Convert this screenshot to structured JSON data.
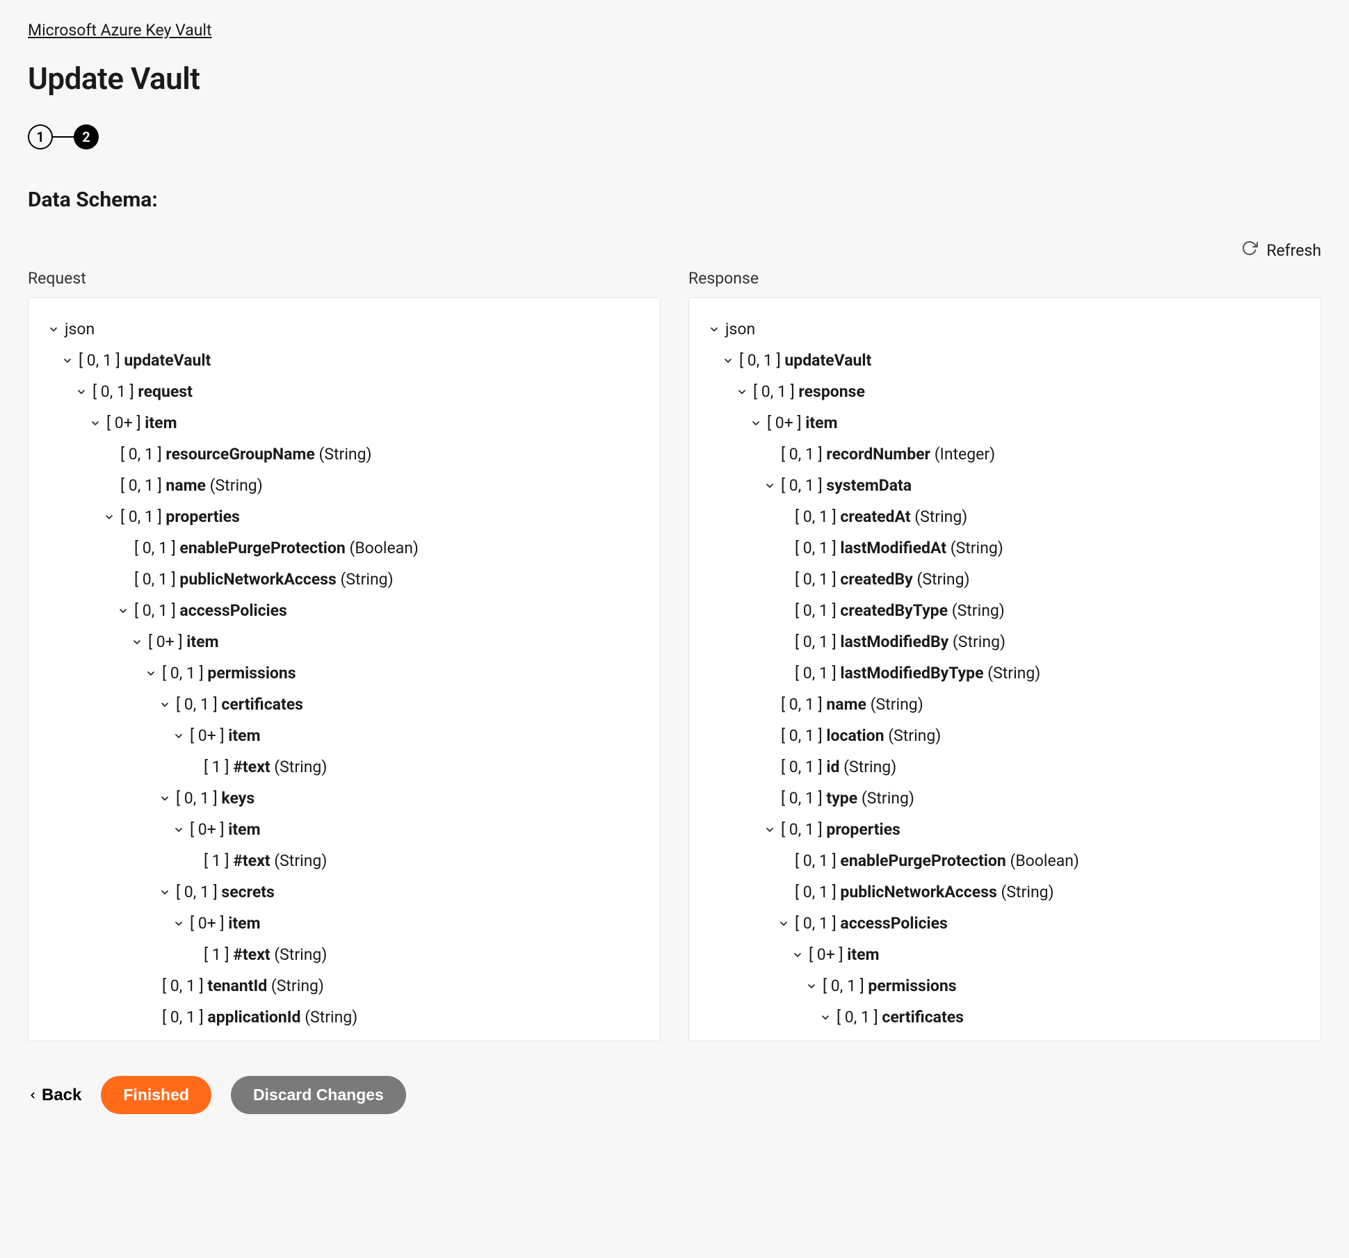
{
  "breadcrumb": "Microsoft Azure Key Vault",
  "page_title": "Update Vault",
  "stepper": {
    "step1": "1",
    "step2": "2"
  },
  "section_title": "Data Schema:",
  "refresh_label": "Refresh",
  "columns": {
    "request_title": "Request",
    "response_title": "Response"
  },
  "request_tree": [
    {
      "depth": 0,
      "chev": true,
      "card": "",
      "name": "json",
      "type": ""
    },
    {
      "depth": 1,
      "chev": true,
      "card": "[ 0, 1 ]",
      "name": "updateVault",
      "type": ""
    },
    {
      "depth": 2,
      "chev": true,
      "card": "[ 0, 1 ]",
      "name": "request",
      "type": ""
    },
    {
      "depth": 3,
      "chev": true,
      "card": "[ 0+ ]",
      "name": "item",
      "type": ""
    },
    {
      "depth": 4,
      "chev": false,
      "card": "[ 0, 1 ]",
      "name": "resourceGroupName",
      "type": "(String)"
    },
    {
      "depth": 4,
      "chev": false,
      "card": "[ 0, 1 ]",
      "name": "name",
      "type": "(String)"
    },
    {
      "depth": 4,
      "chev": true,
      "card": "[ 0, 1 ]",
      "name": "properties",
      "type": ""
    },
    {
      "depth": 5,
      "chev": false,
      "card": "[ 0, 1 ]",
      "name": "enablePurgeProtection",
      "type": "(Boolean)"
    },
    {
      "depth": 5,
      "chev": false,
      "card": "[ 0, 1 ]",
      "name": "publicNetworkAccess",
      "type": "(String)"
    },
    {
      "depth": 5,
      "chev": true,
      "card": "[ 0, 1 ]",
      "name": "accessPolicies",
      "type": ""
    },
    {
      "depth": 6,
      "chev": true,
      "card": "[ 0+ ]",
      "name": "item",
      "type": ""
    },
    {
      "depth": 7,
      "chev": true,
      "card": "[ 0, 1 ]",
      "name": "permissions",
      "type": ""
    },
    {
      "depth": 8,
      "chev": true,
      "card": "[ 0, 1 ]",
      "name": "certificates",
      "type": ""
    },
    {
      "depth": 9,
      "chev": true,
      "card": "[ 0+ ]",
      "name": "item",
      "type": ""
    },
    {
      "depth": 10,
      "chev": false,
      "card": "[ 1 ]",
      "name": "#text",
      "type": "(String)"
    },
    {
      "depth": 8,
      "chev": true,
      "card": "[ 0, 1 ]",
      "name": "keys",
      "type": ""
    },
    {
      "depth": 9,
      "chev": true,
      "card": "[ 0+ ]",
      "name": "item",
      "type": ""
    },
    {
      "depth": 10,
      "chev": false,
      "card": "[ 1 ]",
      "name": "#text",
      "type": "(String)"
    },
    {
      "depth": 8,
      "chev": true,
      "card": "[ 0, 1 ]",
      "name": "secrets",
      "type": ""
    },
    {
      "depth": 9,
      "chev": true,
      "card": "[ 0+ ]",
      "name": "item",
      "type": ""
    },
    {
      "depth": 10,
      "chev": false,
      "card": "[ 1 ]",
      "name": "#text",
      "type": "(String)"
    },
    {
      "depth": 7,
      "chev": false,
      "card": "[ 0, 1 ]",
      "name": "tenantId",
      "type": "(String)"
    },
    {
      "depth": 7,
      "chev": false,
      "card": "[ 0, 1 ]",
      "name": "applicationId",
      "type": "(String)"
    }
  ],
  "response_tree": [
    {
      "depth": 0,
      "chev": true,
      "card": "",
      "name": "json",
      "type": ""
    },
    {
      "depth": 1,
      "chev": true,
      "card": "[ 0, 1 ]",
      "name": "updateVault",
      "type": ""
    },
    {
      "depth": 2,
      "chev": true,
      "card": "[ 0, 1 ]",
      "name": "response",
      "type": ""
    },
    {
      "depth": 3,
      "chev": true,
      "card": "[ 0+ ]",
      "name": "item",
      "type": ""
    },
    {
      "depth": 4,
      "chev": false,
      "card": "[ 0, 1 ]",
      "name": "recordNumber",
      "type": "(Integer)"
    },
    {
      "depth": 4,
      "chev": true,
      "card": "[ 0, 1 ]",
      "name": "systemData",
      "type": ""
    },
    {
      "depth": 5,
      "chev": false,
      "card": "[ 0, 1 ]",
      "name": "createdAt",
      "type": "(String)"
    },
    {
      "depth": 5,
      "chev": false,
      "card": "[ 0, 1 ]",
      "name": "lastModifiedAt",
      "type": "(String)"
    },
    {
      "depth": 5,
      "chev": false,
      "card": "[ 0, 1 ]",
      "name": "createdBy",
      "type": "(String)"
    },
    {
      "depth": 5,
      "chev": false,
      "card": "[ 0, 1 ]",
      "name": "createdByType",
      "type": "(String)"
    },
    {
      "depth": 5,
      "chev": false,
      "card": "[ 0, 1 ]",
      "name": "lastModifiedBy",
      "type": "(String)"
    },
    {
      "depth": 5,
      "chev": false,
      "card": "[ 0, 1 ]",
      "name": "lastModifiedByType",
      "type": "(String)"
    },
    {
      "depth": 4,
      "chev": false,
      "card": "[ 0, 1 ]",
      "name": "name",
      "type": "(String)"
    },
    {
      "depth": 4,
      "chev": false,
      "card": "[ 0, 1 ]",
      "name": "location",
      "type": "(String)"
    },
    {
      "depth": 4,
      "chev": false,
      "card": "[ 0, 1 ]",
      "name": "id",
      "type": "(String)"
    },
    {
      "depth": 4,
      "chev": false,
      "card": "[ 0, 1 ]",
      "name": "type",
      "type": "(String)"
    },
    {
      "depth": 4,
      "chev": true,
      "card": "[ 0, 1 ]",
      "name": "properties",
      "type": ""
    },
    {
      "depth": 5,
      "chev": false,
      "card": "[ 0, 1 ]",
      "name": "enablePurgeProtection",
      "type": "(Boolean)"
    },
    {
      "depth": 5,
      "chev": false,
      "card": "[ 0, 1 ]",
      "name": "publicNetworkAccess",
      "type": "(String)"
    },
    {
      "depth": 5,
      "chev": true,
      "card": "[ 0, 1 ]",
      "name": "accessPolicies",
      "type": ""
    },
    {
      "depth": 6,
      "chev": true,
      "card": "[ 0+ ]",
      "name": "item",
      "type": ""
    },
    {
      "depth": 7,
      "chev": true,
      "card": "[ 0, 1 ]",
      "name": "permissions",
      "type": ""
    },
    {
      "depth": 8,
      "chev": true,
      "card": "[ 0, 1 ]",
      "name": "certificates",
      "type": ""
    }
  ],
  "footer": {
    "back": "Back",
    "finished": "Finished",
    "discard": "Discard Changes"
  }
}
